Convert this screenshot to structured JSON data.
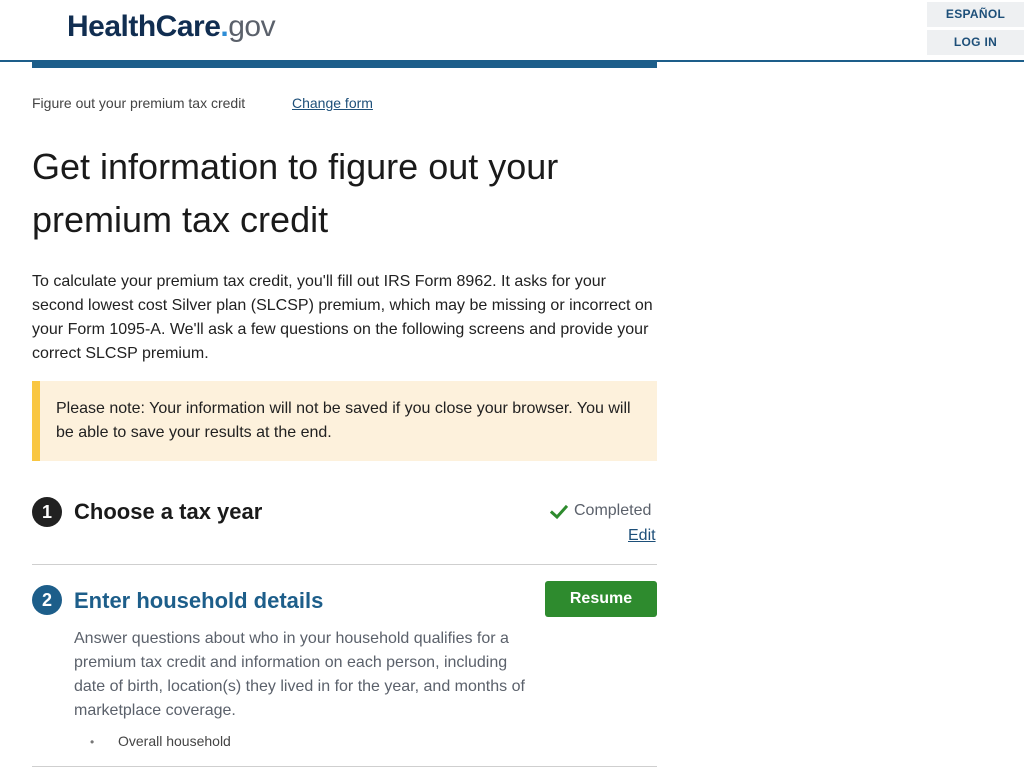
{
  "header": {
    "logo": {
      "part1": "HealthCare",
      "dot": ".",
      "part2": "gov"
    },
    "espanol_label": "ESPAÑOL",
    "login_label": "LOG IN"
  },
  "breadcrumb": {
    "text": "Figure out your premium tax credit",
    "change_link": "Change form"
  },
  "page_title": "Get information to figure out your premium tax credit",
  "intro": "To calculate your premium tax credit, you'll fill out IRS Form 8962. It asks for your second lowest cost Silver plan (SLCSP) premium, which may be missing or incorrect on your Form 1095-A. We'll ask a few questions on the following screens and provide your correct SLCSP premium.",
  "note": "Please note: Your information will not be saved if you close your browser. You will be able to save your results at the end.",
  "steps": [
    {
      "number": "1",
      "title": "Choose a tax year",
      "status": "Completed",
      "edit_label": "Edit"
    },
    {
      "number": "2",
      "title": "Enter household details",
      "button_label": "Resume",
      "description": "Answer questions about who in your household qualifies for a premium tax credit and information on each person, including date of birth, location(s) they lived in for the year, and months of marketplace coverage.",
      "sub_items": [
        "Overall household"
      ]
    }
  ],
  "colors": {
    "brand_blue": "#1d5e8a",
    "success_green": "#2e8b2e",
    "note_bg": "#fdf1dc",
    "note_border": "#f9c642"
  },
  "icons": {
    "completed": "check-icon"
  }
}
